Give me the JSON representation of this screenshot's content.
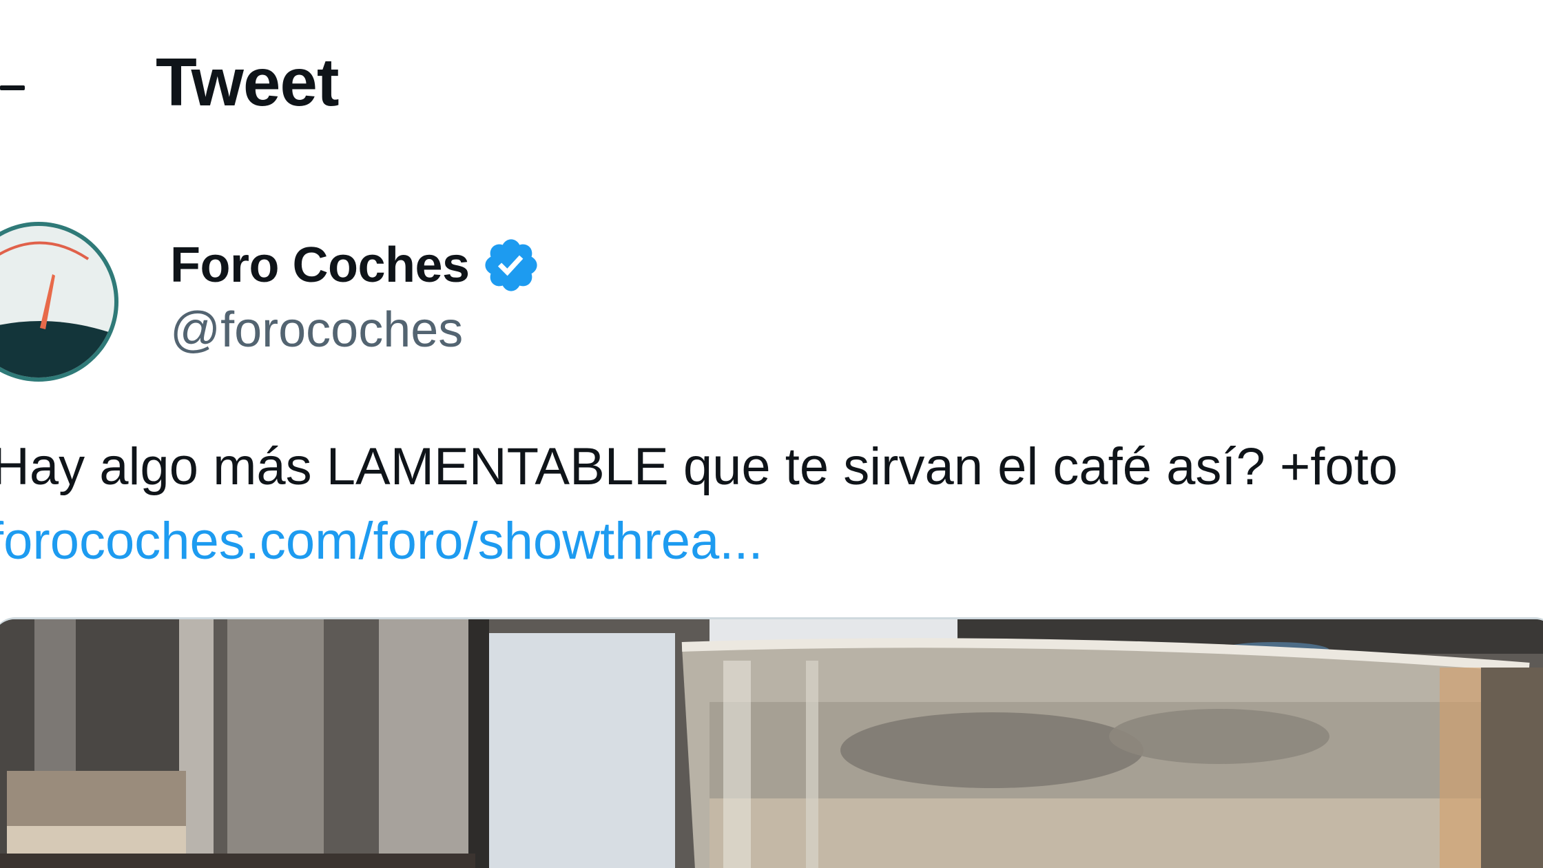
{
  "header": {
    "title": "Tweet",
    "back_icon": "arrow-left-icon"
  },
  "author": {
    "name": "Foro Coches",
    "handle": "@forocoches",
    "verified": true,
    "avatar_icon": "speedometer-gauge-icon"
  },
  "tweet": {
    "text": "Hay algo más LAMENTABLE que te sirvan el café así? +foto",
    "link_text": "forocoches.com/foro/showthrea..."
  },
  "media": {
    "description_icon": "coffee-glass-photo"
  },
  "colors": {
    "text": "#0f1419",
    "secondary": "#536471",
    "link": "#1d9bf0",
    "verified": "#1d9bf0"
  }
}
